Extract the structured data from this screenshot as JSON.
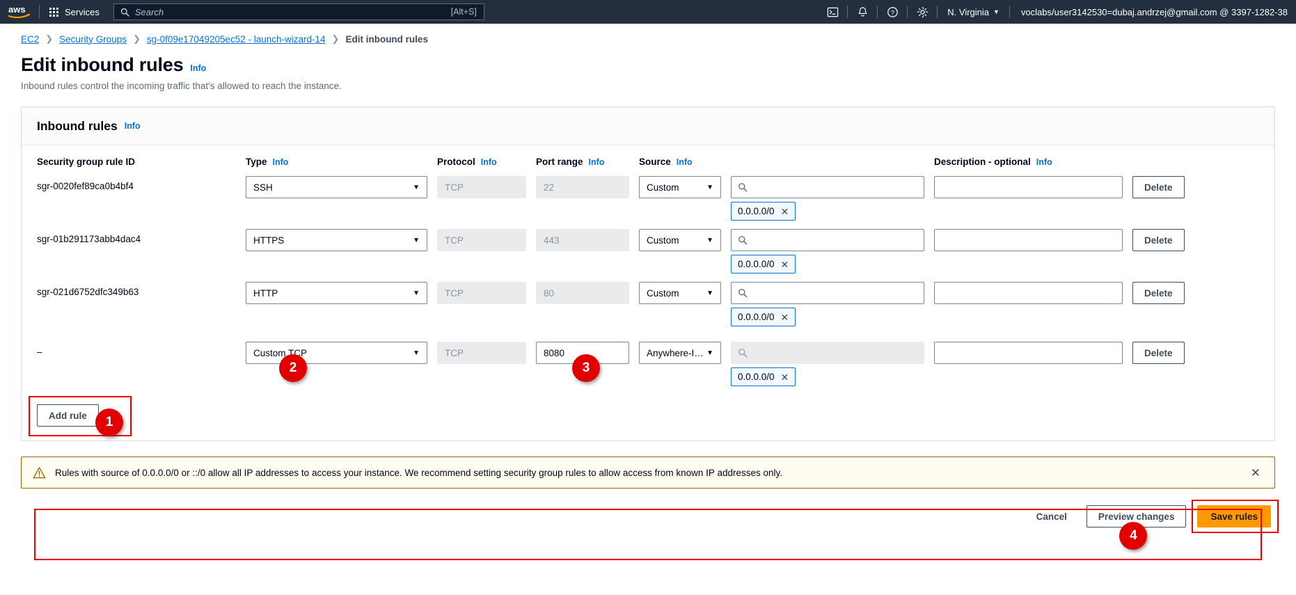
{
  "topnav": {
    "logo": "aws",
    "services_label": "Services",
    "services_icon": "grid-icon",
    "search": {
      "placeholder": "Search",
      "shortcut": "[Alt+S]",
      "icon": "search-icon"
    },
    "icons": [
      "cloudshell-icon",
      "notifications-bell-icon",
      "help-question-icon",
      "settings-gear-icon"
    ],
    "region": "N. Virginia",
    "region_caret": "▼",
    "account": "voclabs/user3142530=dubaj.andrzej@gmail.com @ 3397-1282-38"
  },
  "breadcrumb": {
    "items": [
      "EC2",
      "Security Groups",
      "sg-0f09e17049205ec52 - launch-wizard-14",
      "Edit inbound rules"
    ],
    "separator": "❯"
  },
  "page": {
    "title": "Edit inbound rules",
    "info": "Info",
    "description": "Inbound rules control the incoming traffic that's allowed to reach the instance."
  },
  "panel": {
    "title": "Inbound rules",
    "info": "Info",
    "columns": [
      {
        "label": "Security group rule ID",
        "info": ""
      },
      {
        "label": "Type",
        "info": "Info"
      },
      {
        "label": "Protocol",
        "info": "Info"
      },
      {
        "label": "Port range",
        "info": "Info"
      },
      {
        "label": "Source",
        "info": "Info"
      },
      {
        "label": "",
        "info": ""
      },
      {
        "label": "Description - optional",
        "info": "Info"
      },
      {
        "label": "",
        "info": ""
      }
    ],
    "rows": [
      {
        "rule_id": "sgr-0020fef89ca0b4bf4",
        "type": "SSH",
        "protocol": "TCP",
        "port_range": "22",
        "source": "Custom",
        "cidr": "0.0.0.0/0",
        "description": "",
        "delete_label": "Delete",
        "search_placeholder": "",
        "highlighted": false
      },
      {
        "rule_id": "sgr-01b291173abb4dac4",
        "type": "HTTPS",
        "protocol": "TCP",
        "port_range": "443",
        "source": "Custom",
        "cidr": "0.0.0.0/0",
        "description": "",
        "delete_label": "Delete",
        "search_placeholder": "",
        "highlighted": false
      },
      {
        "rule_id": "sgr-021d6752dfc349b63",
        "type": "HTTP",
        "protocol": "TCP",
        "port_range": "80",
        "source": "Custom",
        "cidr": "0.0.0.0/0",
        "description": "",
        "delete_label": "Delete",
        "search_placeholder": "",
        "highlighted": false
      },
      {
        "rule_id": "–",
        "type": "Custom TCP",
        "protocol": "TCP",
        "port_range": "8080",
        "source": "Anywhere-I…",
        "cidr": "0.0.0.0/0",
        "description": "",
        "delete_label": "Delete",
        "search_placeholder": "",
        "highlighted": true
      }
    ],
    "add_rule_label": "Add rule",
    "caret": "▼",
    "chip_remove": "✕"
  },
  "alert": {
    "icon": "warning-triangle-icon",
    "message": "Rules with source of 0.0.0.0/0 or ::/0 allow all IP addresses to access your instance. We recommend setting security group rules to allow access from known IP addresses only.",
    "dismiss": "✕"
  },
  "footer": {
    "cancel_label": "Cancel",
    "preview_label": "Preview changes",
    "save_label": "Save rules"
  },
  "annotations": [
    {
      "number": "1",
      "target": "add-rule-button"
    },
    {
      "number": "2",
      "target": "type-select-row4"
    },
    {
      "number": "3",
      "target": "port-range-input-row4"
    },
    {
      "number": "4",
      "target": "save-rules-button"
    }
  ],
  "colors": {
    "nav_bg": "#232f3e",
    "link": "#0972d3",
    "primary": "#ff9900",
    "annotation": "#e00000",
    "warning_border": "#906806",
    "warning_bg": "#fffdf0"
  }
}
